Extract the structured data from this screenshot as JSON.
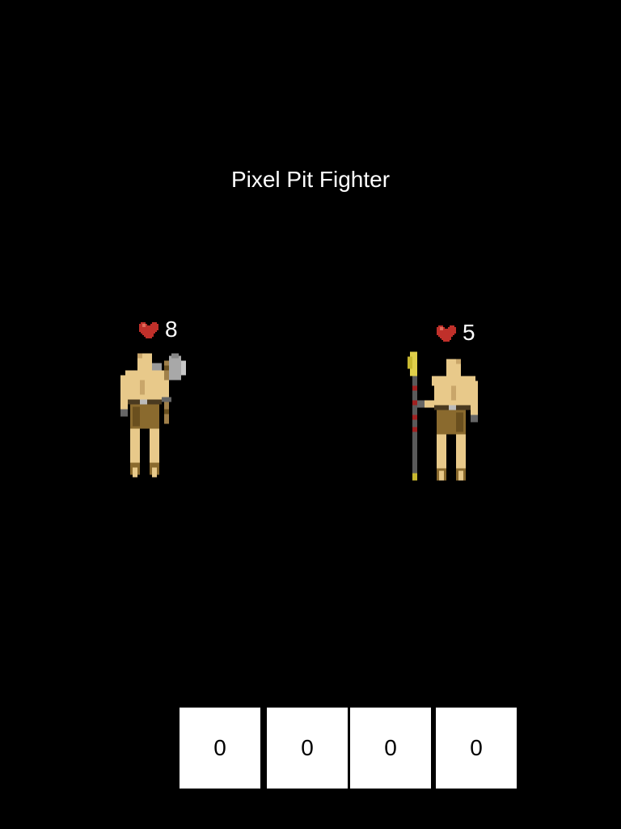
{
  "game": {
    "title": "Pixel Pit Fighter"
  },
  "player": {
    "health": "8",
    "weapon": "axe-icon"
  },
  "enemy": {
    "health": "5",
    "weapon": "spear-icon"
  },
  "slots": [
    "0",
    "0",
    "0",
    "0"
  ],
  "colors": {
    "background": "#000000",
    "heart": "#c0302a",
    "skin": "#e8c98a",
    "loincloth": "#8a6a2e",
    "slot_bg": "#ffffff"
  }
}
